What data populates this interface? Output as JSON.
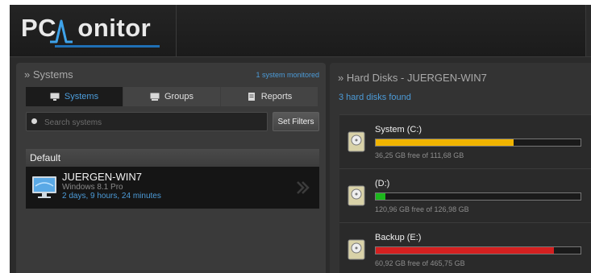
{
  "app": {
    "logo_pc": "PC",
    "logo_m": "M",
    "logo_rest": "onitor"
  },
  "systems_panel": {
    "title": "» Systems",
    "monitored_count": "1 system monitored",
    "tabs": [
      {
        "label": "Systems",
        "icon": "monitor-icon",
        "active": true
      },
      {
        "label": "Groups",
        "icon": "groups-icon",
        "active": false
      },
      {
        "label": "Reports",
        "icon": "document-icon",
        "active": false
      }
    ],
    "search": {
      "placeholder": "Search systems",
      "value": ""
    },
    "set_filters_label": "Set Filters",
    "group_name": "Default",
    "systems": [
      {
        "name": "JUERGEN-WIN7",
        "os": "Windows 8.1 Pro",
        "uptime": "2 days, 9 hours, 24 minutes"
      }
    ]
  },
  "disks_panel": {
    "title": "» Hard Disks - JUERGEN-WIN7",
    "found": "3 hard disks found",
    "disks": [
      {
        "name": "System (C:)",
        "free": "36,25 GB free of 111,68 GB",
        "used_fraction": 0.675,
        "color": "#f0b400"
      },
      {
        "name": " (D:)",
        "free": "120,96 GB free of 126,98 GB",
        "used_fraction": 0.047,
        "color": "#1cb81c"
      },
      {
        "name": "Backup (E:)",
        "free": "60,92 GB free of 465,75 GB",
        "used_fraction": 0.87,
        "color": "#d42020"
      }
    ]
  },
  "colors": {
    "accent": "#4c9bd8",
    "panel": "#3a3a3a",
    "background": "#2b2b2b"
  }
}
